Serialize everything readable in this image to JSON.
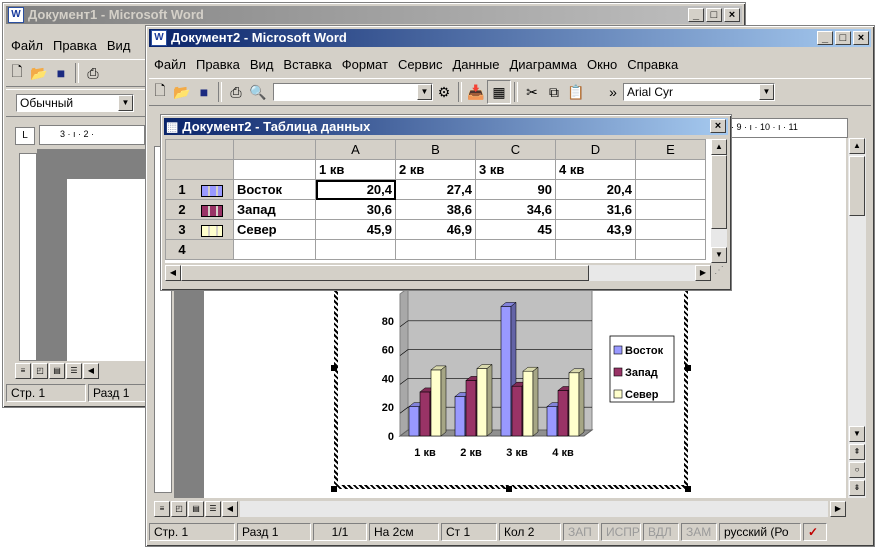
{
  "doc1": {
    "title": "Документ1 - Microsoft Word",
    "menu": [
      "Файл",
      "Правка",
      "Вид"
    ],
    "style_value": "Обычный",
    "ruler_marks": "3 · ı · 2 ·",
    "status": {
      "page": "Стр. 1",
      "section": "Разд 1"
    }
  },
  "doc2": {
    "title": "Документ2 - Microsoft Word",
    "menu": [
      "Файл",
      "Правка",
      "Вид",
      "Вставка",
      "Формат",
      "Сервис",
      "Данные",
      "Диаграмма",
      "Окно",
      "Справка"
    ],
    "font_value": "Arial Cyr",
    "ruler_marks": "· 9 · ı · 10 · ı · 11",
    "status": {
      "page": "Стр. 1",
      "section": "Разд 1",
      "pages": "1/1",
      "at": "На 2см",
      "line": "Ст 1",
      "col": "Кол 2",
      "rec": "ЗАП",
      "trk": "ИСПР",
      "ext": "ВДЛ",
      "ovr": "ЗАМ",
      "lang": "русский (Ро"
    }
  },
  "datasheet": {
    "title": "Документ2 - Таблица данных",
    "col_letters": [
      "A",
      "B",
      "C",
      "D",
      "E"
    ],
    "headers": [
      "1 кв",
      "2 кв",
      "3 кв",
      "4 кв"
    ],
    "rows": [
      {
        "num": "1",
        "label": "Восток",
        "values": [
          "20,4",
          "27,4",
          "90",
          "20,4"
        ],
        "color": "#9999ff"
      },
      {
        "num": "2",
        "label": "Запад",
        "values": [
          "30,6",
          "38,6",
          "34,6",
          "31,6"
        ],
        "color": "#993366"
      },
      {
        "num": "3",
        "label": "Север",
        "values": [
          "45,9",
          "46,9",
          "45",
          "43,9"
        ],
        "color": "#ffffcc"
      },
      {
        "num": "4",
        "label": "",
        "values": [
          "",
          "",
          "",
          ""
        ],
        "color": ""
      }
    ]
  },
  "chart_data": {
    "type": "bar",
    "categories": [
      "1 кв",
      "2 кв",
      "3 кв",
      "4 кв"
    ],
    "series": [
      {
        "name": "Восток",
        "values": [
          20.4,
          27.4,
          90,
          20.4
        ],
        "color": "#9999ff"
      },
      {
        "name": "Запад",
        "values": [
          30.6,
          38.6,
          34.6,
          31.6
        ],
        "color": "#993366"
      },
      {
        "name": "Север",
        "values": [
          45.9,
          46.9,
          45,
          43.9
        ],
        "color": "#ffffcc"
      }
    ],
    "yticks": [
      "0",
      "20",
      "40",
      "60",
      "80"
    ],
    "ylim": [
      0,
      100
    ],
    "grid": true,
    "legend": "right"
  }
}
